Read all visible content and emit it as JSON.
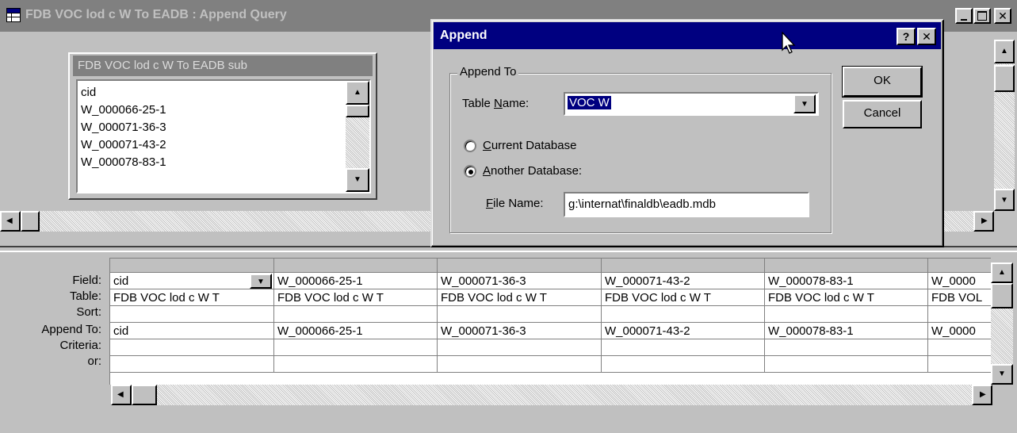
{
  "window": {
    "title": "FDB VOC lod c W To EADB : Append Query",
    "icon": "query-grid-icon"
  },
  "field_list": {
    "title": "FDB VOC lod c W To EADB sub",
    "items": [
      "cid",
      "W_000066-25-1",
      "W_000071-36-3",
      "W_000071-43-2",
      "W_000078-83-1"
    ]
  },
  "dialog": {
    "title": "Append",
    "help_label": "?",
    "close_label": "✕",
    "group_label": "Append To",
    "table_name_label_pre": "Table ",
    "table_name_label_ul": "N",
    "table_name_label_post": "ame:",
    "table_name_value": "VOC W",
    "current_db_ul": "C",
    "current_db_rest": "urrent Database",
    "another_db_ul": "A",
    "another_db_rest": "nother Database:",
    "file_name_ul": "F",
    "file_name_rest": "ile Name:",
    "file_name_value": "g:\\internat\\finaldb\\eadb.mdb",
    "ok_label": "OK",
    "cancel_label": "Cancel"
  },
  "grid": {
    "row_labels": [
      "Field:",
      "Table:",
      "Sort:",
      "Append To:",
      "Criteria:",
      "or:"
    ],
    "columns": [
      {
        "field": "cid",
        "table": "FDB VOC lod c W T",
        "sort": "",
        "append_to": "cid"
      },
      {
        "field": "W_000066-25-1",
        "table": "FDB VOC lod c W T",
        "sort": "",
        "append_to": "W_000066-25-1"
      },
      {
        "field": "W_000071-36-3",
        "table": "FDB VOC lod c W T",
        "sort": "",
        "append_to": "W_000071-36-3"
      },
      {
        "field": "W_000071-43-2",
        "table": "FDB VOC lod c W T",
        "sort": "",
        "append_to": "W_000071-43-2"
      },
      {
        "field": "W_000078-83-1",
        "table": "FDB VOC lod c W T",
        "sort": "",
        "append_to": "W_000078-83-1"
      },
      {
        "field": "W_0000",
        "table": "FDB VOL",
        "sort": "",
        "append_to": "W_0000"
      }
    ]
  }
}
